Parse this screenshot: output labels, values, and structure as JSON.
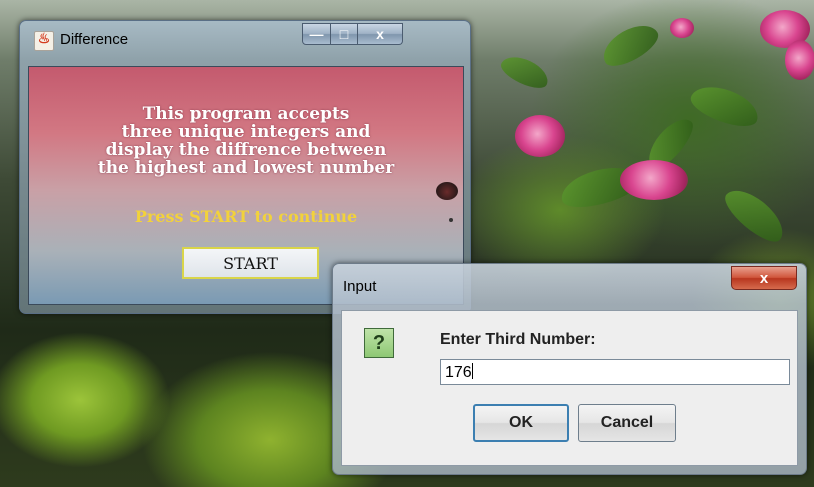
{
  "difference_window": {
    "title": "Difference",
    "buttons": {
      "minimize": "—",
      "maximize": "□",
      "close": "x"
    },
    "description": "This program accepts\nthree unique integers and\ndisplay the diffrence between\nthe highest and lowest number",
    "press_text": "Press START to continue",
    "start_label": "START"
  },
  "input_dialog": {
    "title": "Input",
    "close_label": "x",
    "icon_glyph": "?",
    "prompt": "Enter Third Number:",
    "field_value": "176",
    "ok_label": "OK",
    "cancel_label": "Cancel"
  },
  "colors": {
    "press_text": "#f2d23a",
    "start_border": "#d9d54a",
    "ok_focus_border": "#3c7fb1",
    "close_red": "#c7462c"
  }
}
